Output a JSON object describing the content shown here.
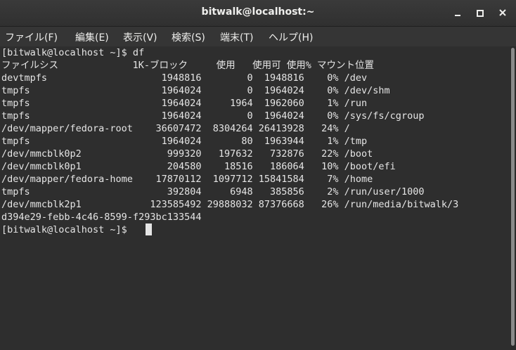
{
  "window": {
    "title": "bitwalk@localhost:~"
  },
  "menubar": {
    "items": [
      "ファイル(F)",
      "編集(E)",
      "表示(V)",
      "検索(S)",
      "端末(T)",
      "ヘルプ(H)"
    ]
  },
  "terminal": {
    "lines": [
      "[bitwalk@localhost ~]$ df",
      "ファイルシス             1K-ブロック     使用   使用可 使用% マウント位置",
      "devtmpfs                    1948816        0  1948816    0% /dev",
      "tmpfs                       1964024        0  1964024    0% /dev/shm",
      "tmpfs                       1964024     1964  1962060    1% /run",
      "tmpfs                       1964024        0  1964024    0% /sys/fs/cgroup",
      "/dev/mapper/fedora-root    36607472  8304264 26413928   24% /",
      "tmpfs                       1964024       80  1963944    1% /tmp",
      "/dev/mmcblk0p2               999320   197632   732876   22% /boot",
      "/dev/mmcblk0p1               204580    18516   186064   10% /boot/efi",
      "/dev/mapper/fedora-home    17870112  1097712 15841584    7% /home",
      "tmpfs                        392804     6948   385856    2% /run/user/1000",
      "/dev/mmcblk2p1            123585492 29888032 87376668   26% /run/media/bitwalk/3",
      "d394e29-febb-4c46-8599-f293bc133544",
      "[bitwalk@localhost ~]$ "
    ]
  },
  "colors": {
    "titlebar": "#303030",
    "terminal_bg": "#2e2e2e",
    "terminal_fg": "#e5e5e5"
  },
  "icons": {
    "minimize": "minimize-icon",
    "maximize": "maximize-icon",
    "close": "close-icon"
  }
}
